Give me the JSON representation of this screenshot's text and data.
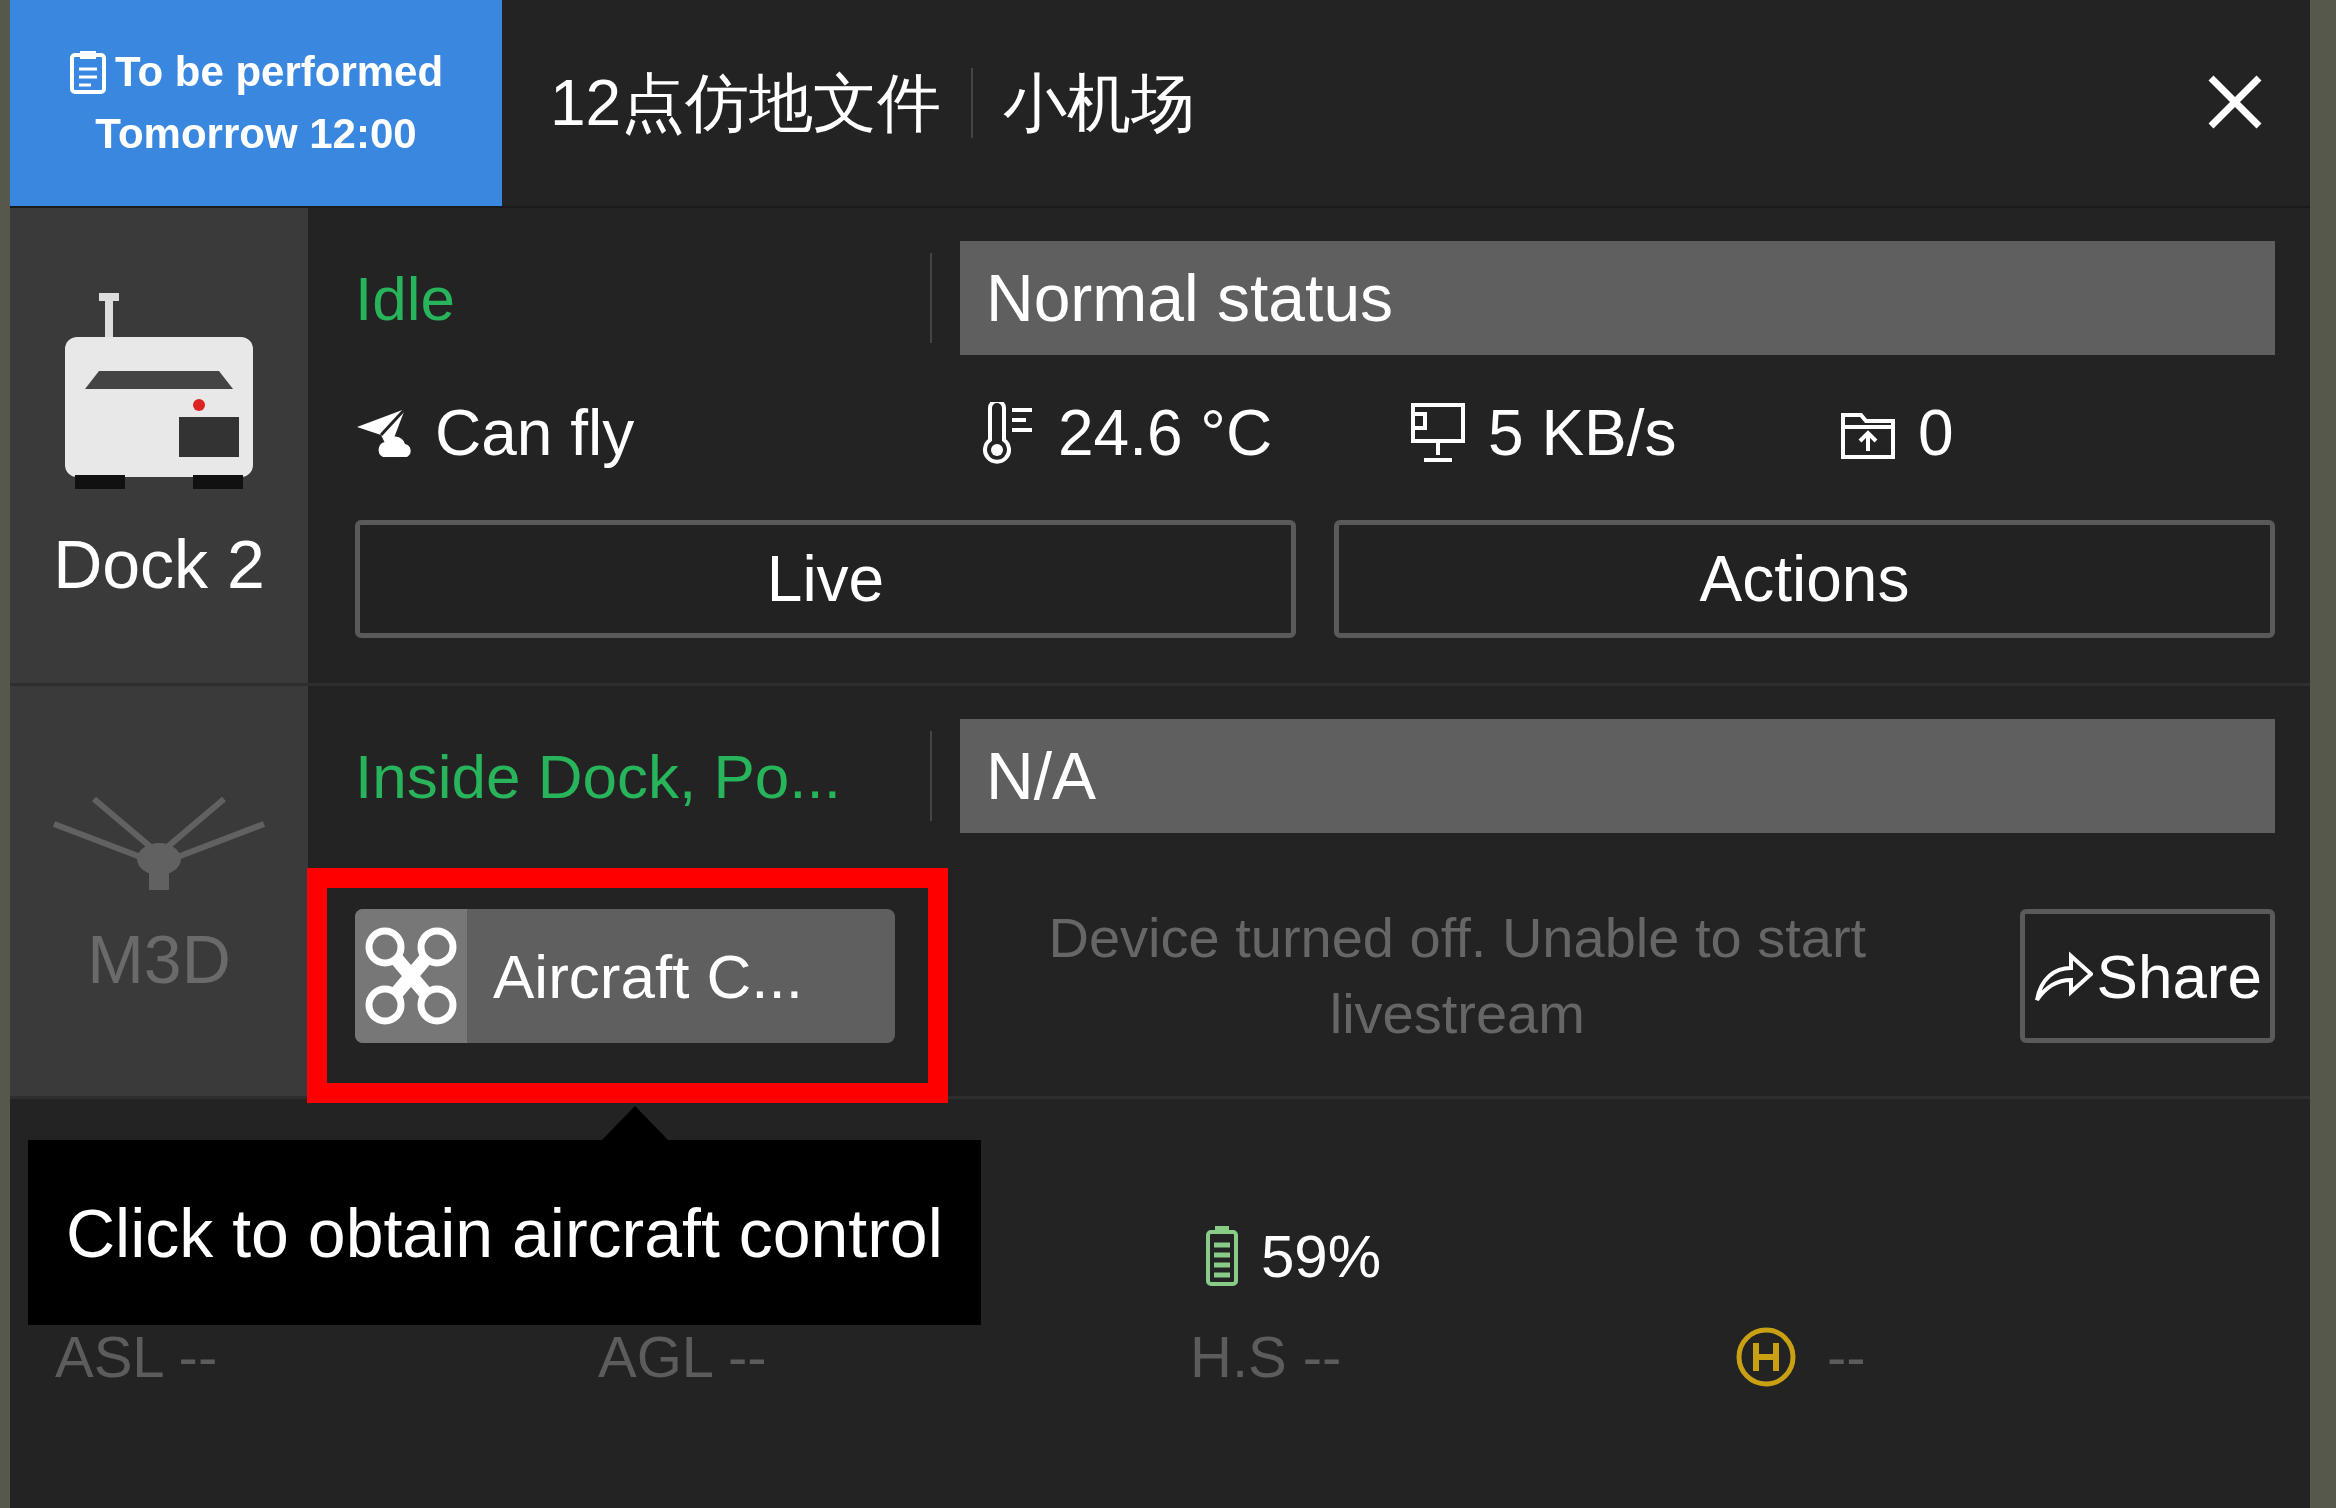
{
  "task": {
    "status": "To be performed",
    "time": "Tomorrow 12:00"
  },
  "title": {
    "file": "12点仿地文件",
    "site": "小机场"
  },
  "devices": [
    {
      "kind": "dock",
      "name": "Dock 2",
      "online": true,
      "status": "Idle",
      "alert": "Normal status",
      "stats": [
        {
          "kind": "flight",
          "text": "Can fly"
        },
        {
          "kind": "temperature",
          "text": "24.6 °C"
        },
        {
          "kind": "network",
          "text": "5 KB/s"
        },
        {
          "kind": "storage",
          "text": "0"
        }
      ],
      "buttons": [
        "Live",
        "Actions"
      ]
    },
    {
      "kind": "aircraft",
      "name": "M3D",
      "online": false,
      "status": "Inside Dock, Po...",
      "alert": "N/A",
      "control_button": "Aircraft C...",
      "highlighted": true,
      "message": "Device turned off. Unable to start livestream",
      "share_button": "Share"
    }
  ],
  "battery": "59%",
  "telemetry": [
    {
      "kind": "label",
      "text": "ASL --"
    },
    {
      "kind": "label",
      "text": "AGL --"
    },
    {
      "kind": "label",
      "text": "H.S --"
    },
    {
      "kind": "home",
      "text": "--"
    }
  ],
  "tooltip": "Click to obtain aircraft control"
}
